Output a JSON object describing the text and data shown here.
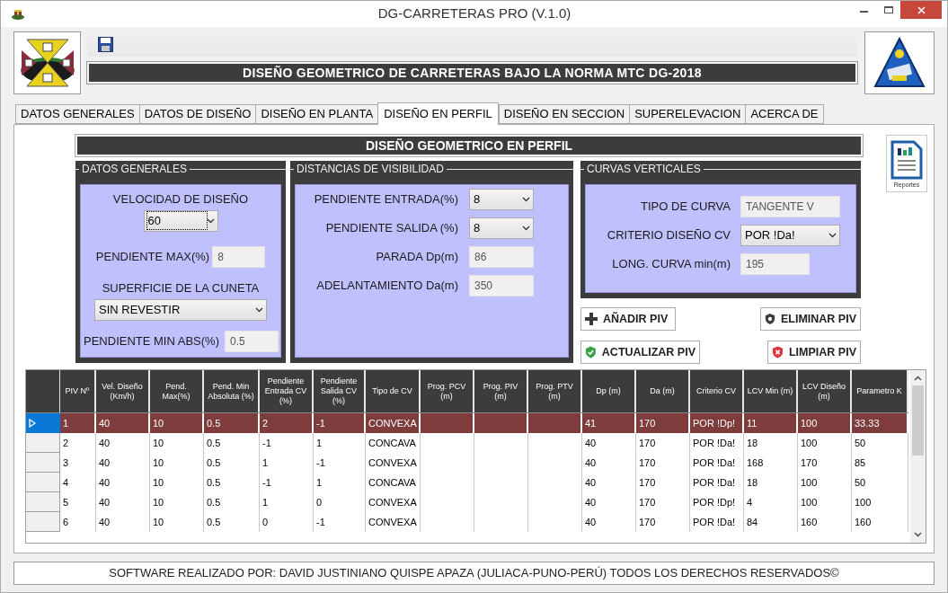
{
  "window": {
    "title": "DG-CARRETERAS PRO (V.1.0)"
  },
  "header": {
    "title": "DISEÑO GEOMETRICO DE CARRETERAS BAJO LA NORMA MTC DG-2018"
  },
  "tabs": [
    {
      "label": "DATOS GENERALES",
      "selected": false
    },
    {
      "label": "DATOS DE DISEÑO",
      "selected": false
    },
    {
      "label": "DISEÑO EN PLANTA",
      "selected": false
    },
    {
      "label": "DISEÑO EN PERFIL",
      "selected": true
    },
    {
      "label": "DISEÑO EN SECCION",
      "selected": false
    },
    {
      "label": "SUPERELEVACION",
      "selected": false
    },
    {
      "label": "ACERCA DE",
      "selected": false
    }
  ],
  "section": {
    "title": "DISEÑO GEOMETRICO EN PERFIL",
    "report_button": "Reportes"
  },
  "groups": [
    {
      "title": "DATOS GENERALES",
      "fields": [
        {
          "label": "VELOCIDAD DE DISEÑO",
          "kind": "dropdown",
          "value": "60",
          "focused": true
        },
        {
          "label": "PENDIENTE MAX(%)",
          "kind": "readonly",
          "value": "8"
        },
        {
          "label": "SUPERFICIE DE LA CUNETA",
          "kind": "dropdown",
          "value": "SIN REVESTIR",
          "focused": false
        },
        {
          "label": "PENDIENTE MIN ABS(%)",
          "kind": "readonly",
          "value": "0.5"
        }
      ]
    },
    {
      "title": "DISTANCIAS DE VISIBILIDAD",
      "fields": [
        {
          "label": "PENDIENTE ENTRADA(%)",
          "kind": "dropdown",
          "value": "8",
          "focused": false
        },
        {
          "label": "PENDIENTE SALIDA (%)",
          "kind": "dropdown",
          "value": "8",
          "focused": false
        },
        {
          "label": "PARADA Dp(m)",
          "kind": "readonly",
          "value": "86"
        },
        {
          "label": "ADELANTAMIENTO Da(m)",
          "kind": "readonly",
          "value": "350"
        }
      ]
    },
    {
      "title": "CURVAS VERTICALES",
      "fields": [
        {
          "label": "TIPO DE CURVA",
          "kind": "readonly",
          "value": "TANGENTE V"
        },
        {
          "label": "CRITERIO DISEÑO CV",
          "kind": "dropdown",
          "value": "POR !Da!",
          "focused": false
        },
        {
          "label": "LONG. CURVA min(m)",
          "kind": "readonly",
          "value": "195"
        }
      ]
    }
  ],
  "actions": [
    {
      "label": "AÑADIR PIV"
    },
    {
      "label": "ELIMINAR PIV"
    },
    {
      "label": "ACTUALIZAR PIV"
    },
    {
      "label": "LIMPIAR PIV"
    }
  ],
  "table": {
    "columns": [
      "PIV Nº",
      "Vel. Diseño (Km/h)",
      "Pend. Max(%)",
      "Pend. Min Absoluta (%)",
      "Pendiente Entrada CV (%)",
      "Pendiente Salida CV (%)",
      "Tipo de CV",
      "Prog. PCV (m)",
      "Prog. PIV (m)",
      "Prog. PTV (m)",
      "Dp (m)",
      "Da (m)",
      "Criterio CV",
      "LCV Min (m)",
      "LCV Diseño (m)",
      "Parametro K"
    ],
    "rows": [
      {
        "selected": true,
        "cells": [
          "1",
          "40",
          "10",
          "0.5",
          "2",
          "-1",
          "CONVEXA",
          null,
          null,
          null,
          "41",
          "170",
          "POR !Dp!",
          "11",
          "100",
          "33.33"
        ]
      },
      {
        "selected": false,
        "cells": [
          "2",
          "40",
          "10",
          "0.5",
          "-1",
          "1",
          "CONCAVA",
          null,
          null,
          null,
          "40",
          "170",
          "POR !Da!",
          "18",
          "100",
          "50"
        ]
      },
      {
        "selected": false,
        "cells": [
          "3",
          "40",
          "10",
          "0.5",
          "1",
          "-1",
          "CONVEXA",
          null,
          null,
          null,
          "40",
          "170",
          "POR !Da!",
          "168",
          "170",
          "85"
        ]
      },
      {
        "selected": false,
        "cells": [
          "4",
          "40",
          "10",
          "0.5",
          "-1",
          "1",
          "CONCAVA",
          null,
          null,
          null,
          "40",
          "170",
          "POR !Da!",
          "18",
          "100",
          "50"
        ]
      },
      {
        "selected": false,
        "cells": [
          "5",
          "40",
          "10",
          "0.5",
          "1",
          "0",
          "CONVEXA",
          null,
          null,
          null,
          "40",
          "170",
          "POR !Dp!",
          "4",
          "100",
          "100"
        ]
      },
      {
        "selected": false,
        "cells": [
          "6",
          "40",
          "10",
          "0.5",
          "0",
          "-1",
          "CONVEXA",
          null,
          null,
          null,
          "40",
          "170",
          "POR !Da!",
          "84",
          "160",
          "160"
        ]
      }
    ]
  },
  "footer": {
    "text": "SOFTWARE REALIZADO POR: DAVID JUSTINIANO QUISPE APAZA (JULIACA-PUNO-PERÚ) TODOS LOS DERECHOS RESERVADOS©"
  }
}
